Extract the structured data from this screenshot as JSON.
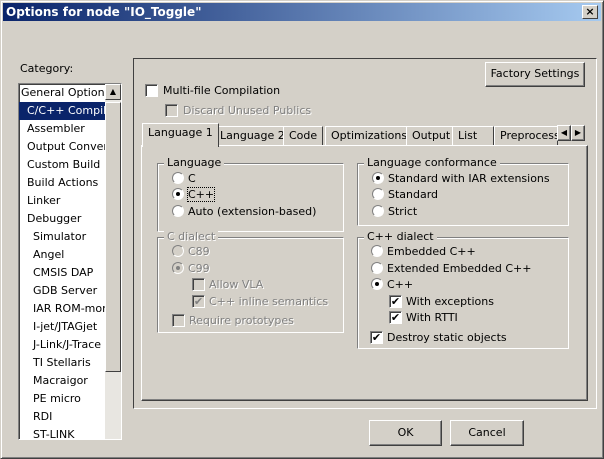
{
  "window": {
    "title": "Options for node \"IO_Toggle\"",
    "close": "×"
  },
  "category": {
    "label": "Category:",
    "items": [
      "General Options",
      "C/C++ Compiler",
      "Assembler",
      "Output Converter",
      "Custom Build",
      "Build Actions",
      "Linker",
      "Debugger",
      "Simulator",
      "Angel",
      "CMSIS DAP",
      "GDB Server",
      "IAR ROM-monitor",
      "I-jet/JTAGjet",
      "J-Link/J-Trace",
      "TI Stellaris",
      "Macraigor",
      "PE micro",
      "RDI",
      "ST-LINK"
    ],
    "selected": "C/C++ Compiler"
  },
  "factory_settings": "Factory Settings",
  "multi_file": {
    "label": "Multi-file Compilation",
    "checked": false
  },
  "discard_unused": {
    "label": "Discard Unused Publics",
    "checked": false,
    "disabled": true
  },
  "tabs": [
    "Language 1",
    "Language 2",
    "Code",
    "Optimizations",
    "Output",
    "List",
    "Preprocess"
  ],
  "active_tab": "Language 1",
  "language": {
    "title": "Language",
    "options": [
      "C",
      "C++",
      "Auto (extension-based)"
    ],
    "selected": "C++"
  },
  "conformance": {
    "title": "Language conformance",
    "options": [
      "Standard with IAR extensions",
      "Standard",
      "Strict"
    ],
    "selected": "Standard with IAR extensions"
  },
  "c_dialect": {
    "title": "C dialect",
    "options": [
      "C89",
      "C99"
    ],
    "selected": "C99",
    "allow_vla": "Allow VLA",
    "inline": "C++ inline semantics",
    "require_proto": "Require prototypes"
  },
  "cpp_dialect": {
    "title": "C++ dialect",
    "options": [
      "Embedded C++",
      "Extended Embedded C++",
      "C++"
    ],
    "selected": "C++",
    "exceptions": "With exceptions",
    "rtti": "With RTTI",
    "destroy": "Destroy static objects"
  },
  "buttons": {
    "ok": "OK",
    "cancel": "Cancel"
  },
  "check": "✔"
}
